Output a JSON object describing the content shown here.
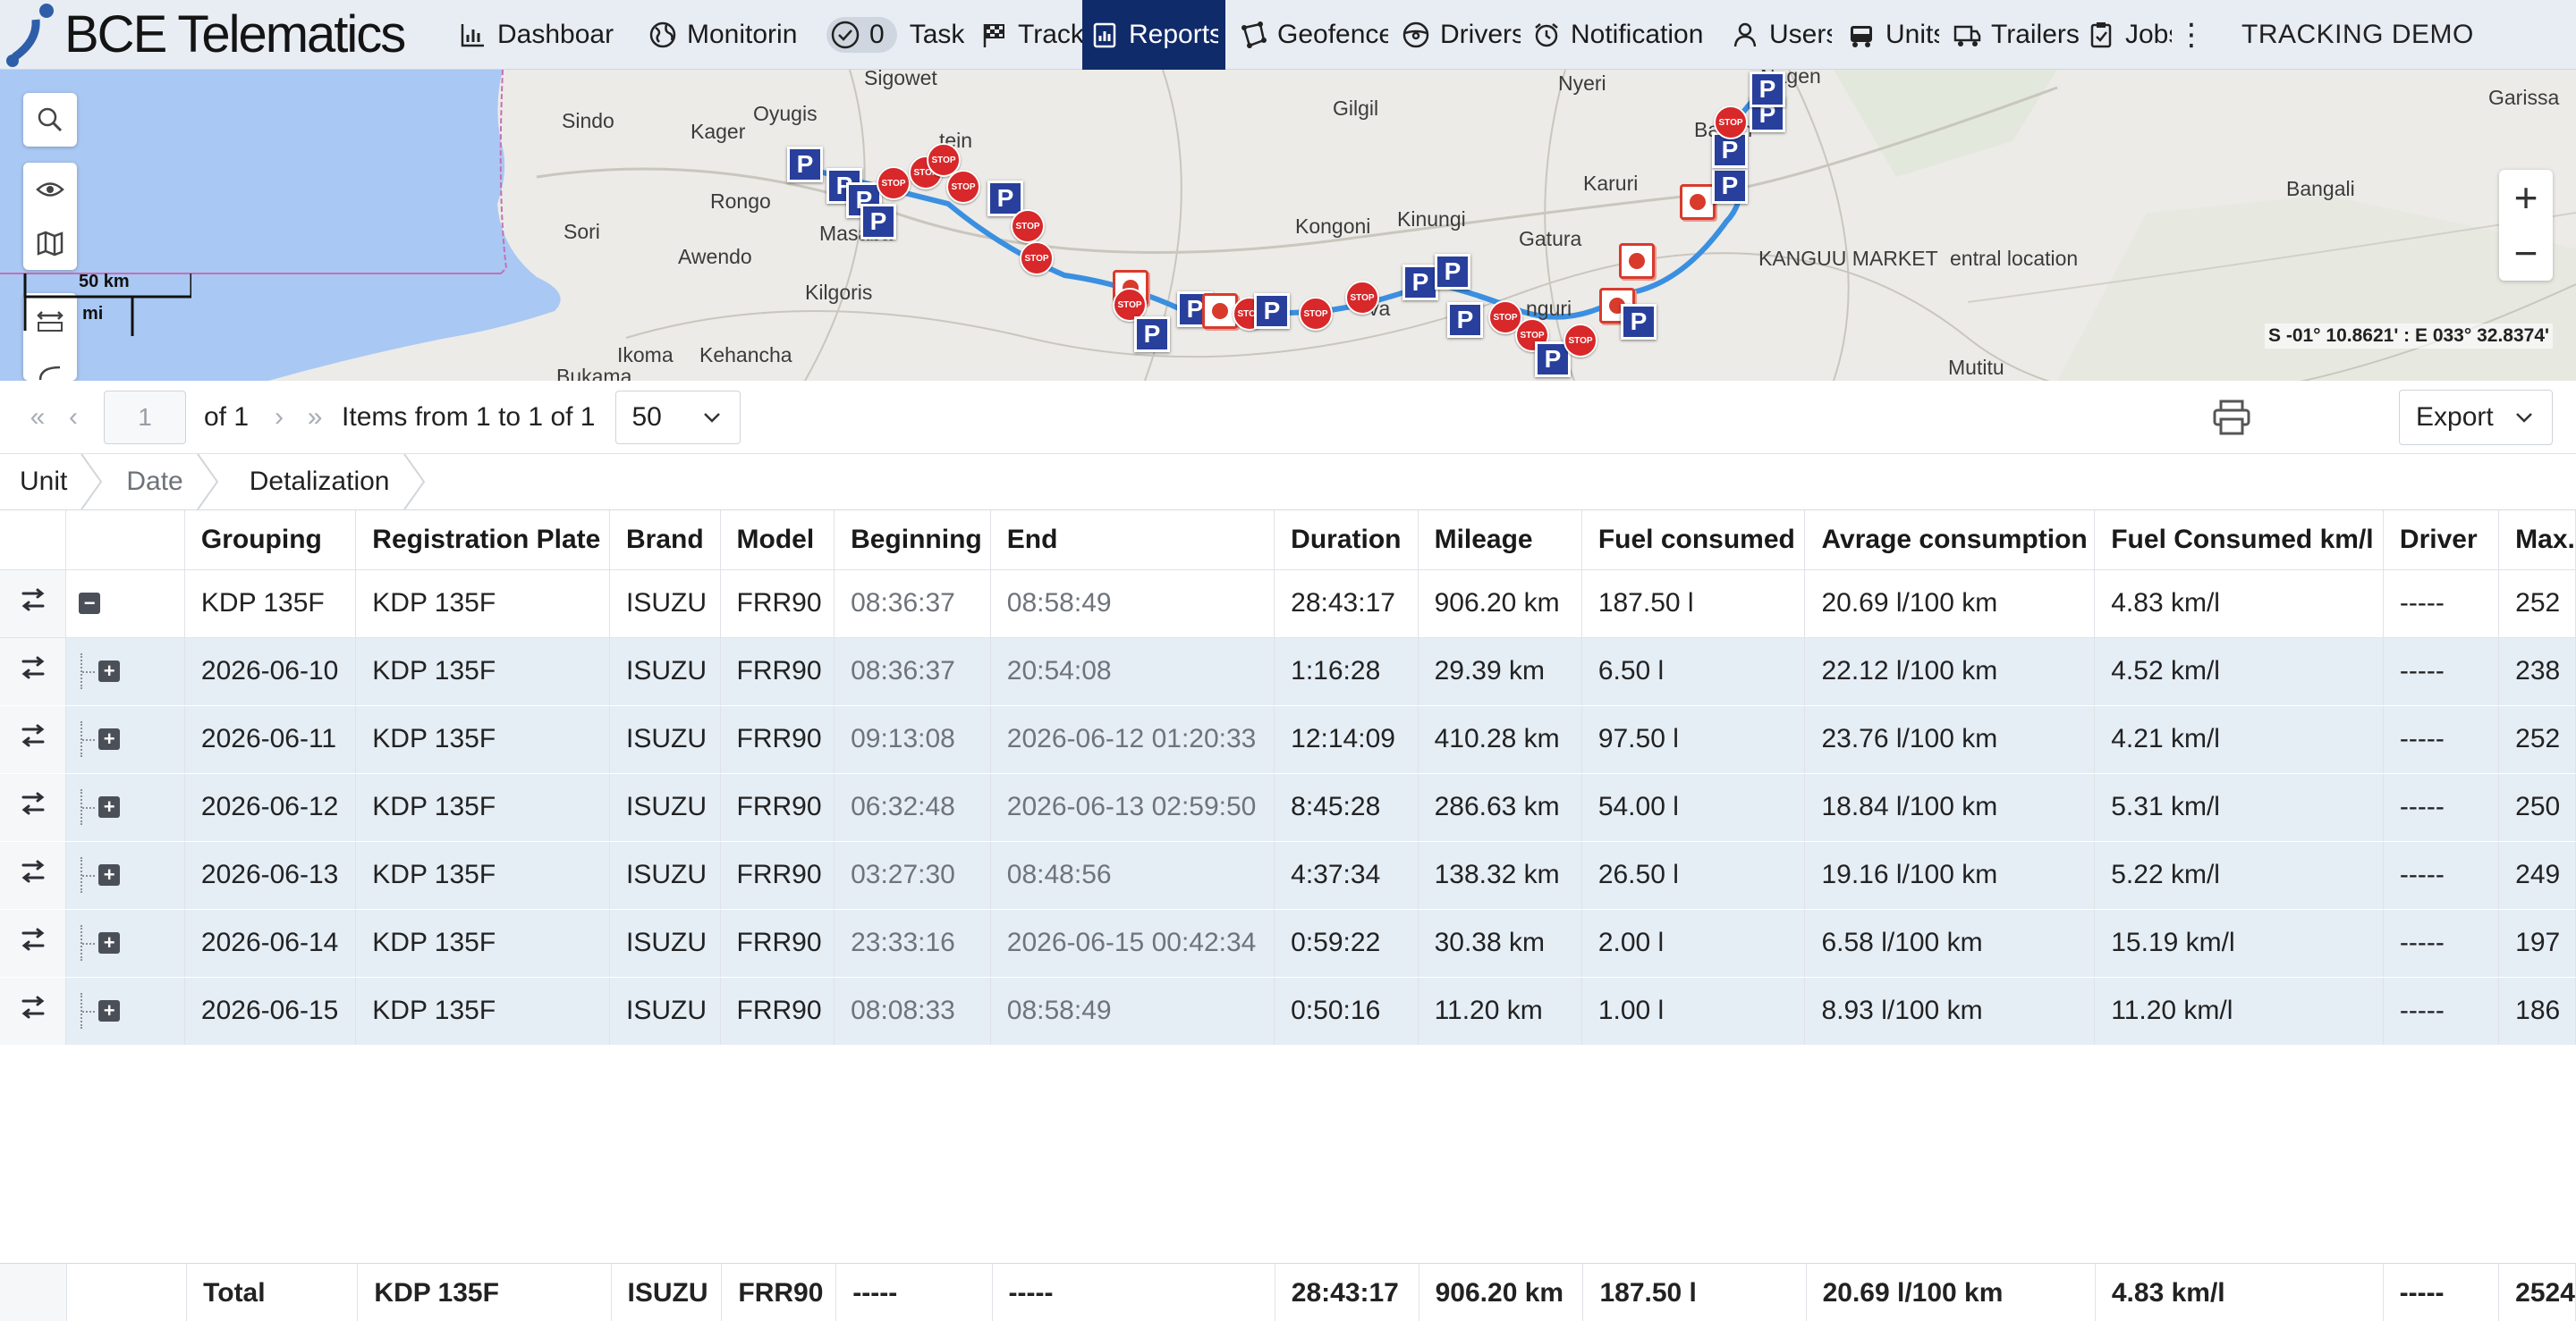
{
  "brand": {
    "name": "BCE Telematics"
  },
  "nav": {
    "items": [
      {
        "label": "Dashboar",
        "icon": "bar-chart-icon"
      },
      {
        "label": "Monitorin",
        "icon": "globe-icon"
      },
      {
        "label": "Task",
        "icon": "check-circle-icon",
        "count": "0"
      },
      {
        "label": "Tracks",
        "icon": "checkered-flag-icon"
      },
      {
        "label": "Reports",
        "icon": "report-icon",
        "active": true
      },
      {
        "label": "Geofence",
        "icon": "geofence-icon"
      },
      {
        "label": "Drivers",
        "icon": "steering-wheel-icon"
      },
      {
        "label": "Notification",
        "icon": "alarm-clock-icon"
      },
      {
        "label": "Users",
        "icon": "user-icon"
      },
      {
        "label": "Units",
        "icon": "truck-icon"
      },
      {
        "label": "Trailers",
        "icon": "trailer-icon"
      },
      {
        "label": "Jobs",
        "icon": "clipboard-icon"
      }
    ],
    "more_icon": "kebab-menu-icon",
    "account": "TRACKING DEMO"
  },
  "map": {
    "labels": [
      "Sigowet",
      "Nyeri",
      "Gilgil",
      "Sindo",
      "Kager",
      "Oyugis",
      "tein",
      "Rongo",
      "Sori",
      "Awendo",
      "Kilgoris",
      "Kongoni",
      "Kinungi",
      "Gatura",
      "Karuri",
      "Barich",
      "Bangali",
      "Garissa",
      "KANGUU MARKET",
      "entral location",
      "Ikoma",
      "Kehancha",
      "Bukama",
      "Mutitu",
      "Masaba",
      "Nagen",
      "nguri",
      "va",
      "M"
    ],
    "scale_km": "50 km",
    "scale_mi": "mi",
    "coordinates": "S -01° 10.8621' : E 033° 32.8374'",
    "zoom_in": "+",
    "zoom_out": "−"
  },
  "pager": {
    "page": "1",
    "of": "of 1",
    "range": "Items from 1 to 1 of 1",
    "page_size": "50",
    "export": "Export"
  },
  "breadcrumb": [
    "Unit",
    "Date",
    "Detalization"
  ],
  "table": {
    "headers": [
      "Grouping",
      "Registration Plate",
      "Brand",
      "Model",
      "Beginning",
      "End",
      "Duration",
      "Mileage",
      "Fuel consumed",
      "Avrage consumption",
      "Fuel Consumed km/l",
      "Driver",
      "Max."
    ],
    "group": [
      "KDP 135F",
      "KDP 135F",
      "ISUZU",
      "FRR90",
      "08:36:37",
      "08:58:49",
      "28:43:17",
      "906.20 km",
      "187.50 l",
      "20.69 l/100 km",
      "4.83 km/l",
      "-----",
      "252"
    ],
    "rows": [
      [
        "2026-06-10",
        "KDP 135F",
        "ISUZU",
        "FRR90",
        "08:36:37",
        "20:54:08",
        "1:16:28",
        "29.39 km",
        "6.50 l",
        "22.12 l/100 km",
        "4.52 km/l",
        "-----",
        "238"
      ],
      [
        "2026-06-11",
        "KDP 135F",
        "ISUZU",
        "FRR90",
        "09:13:08",
        "2026-06-12 01:20:33",
        "12:14:09",
        "410.28 km",
        "97.50 l",
        "23.76 l/100 km",
        "4.21 km/l",
        "-----",
        "252"
      ],
      [
        "2026-06-12",
        "KDP 135F",
        "ISUZU",
        "FRR90",
        "06:32:48",
        "2026-06-13 02:59:50",
        "8:45:28",
        "286.63 km",
        "54.00 l",
        "18.84 l/100 km",
        "5.31 km/l",
        "-----",
        "250"
      ],
      [
        "2026-06-13",
        "KDP 135F",
        "ISUZU",
        "FRR90",
        "03:27:30",
        "08:48:56",
        "4:37:34",
        "138.32 km",
        "26.50 l",
        "19.16 l/100 km",
        "5.22 km/l",
        "-----",
        "249"
      ],
      [
        "2026-06-14",
        "KDP 135F",
        "ISUZU",
        "FRR90",
        "23:33:16",
        "2026-06-15 00:42:34",
        "0:59:22",
        "30.38 km",
        "2.00 l",
        "6.58 l/100 km",
        "15.19 km/l",
        "-----",
        "197"
      ],
      [
        "2026-06-15",
        "KDP 135F",
        "ISUZU",
        "FRR90",
        "08:08:33",
        "08:58:49",
        "0:50:16",
        "11.20 km",
        "1.00 l",
        "8.93 l/100 km",
        "11.20 km/l",
        "-----",
        "186"
      ]
    ],
    "total": [
      "Total",
      "KDP 135F",
      "ISUZU",
      "FRR90",
      "-----",
      "-----",
      "28:43:17",
      "906.20 km",
      "187.50 l",
      "20.69 l/100 km",
      "4.83 km/l",
      "-----",
      "2524"
    ]
  },
  "colors": {
    "nav_active": "#102b6a",
    "row_alt": "#e5edf5",
    "route": "#3b8fe0",
    "parking": "#283f9c",
    "stop": "#d8282a"
  }
}
